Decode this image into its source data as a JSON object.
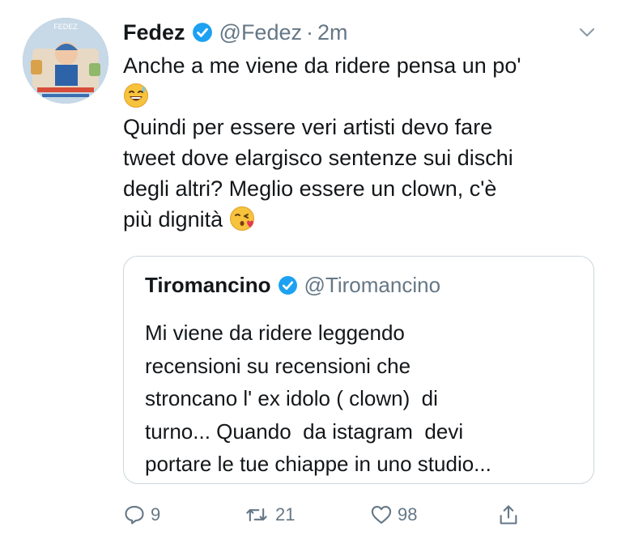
{
  "tweet": {
    "author_name": "Fedez",
    "author_handle": "@Fedez",
    "separator": "·",
    "time": "2m",
    "text_lines": [
      "Anche a me viene da ridere pensa un po'",
      "",
      "Quindi per essere veri artisti devo fare",
      "tweet dove elargisco sentenze sui dischi",
      "degli altri? Meglio essere un clown, c'è",
      "più dignità"
    ],
    "avatar_caption": "FEDEZ"
  },
  "quoted_tweet": {
    "author_name": "Tiromancino",
    "author_handle": "@Tiromancino",
    "text_lines": [
      "Mi viene da ridere leggendo",
      "recensioni su recensioni che",
      "stroncano l' ex idolo ( clown)  di",
      "turno... Quando  da istagram  devi",
      "portare le tue chiappe in uno studio..."
    ]
  },
  "actions": {
    "replies": "9",
    "retweets": "21",
    "likes": "98"
  },
  "icons": {
    "verified": "verified-badge-icon",
    "caret": "chevron-down-icon",
    "reply": "reply-icon",
    "retweet": "retweet-icon",
    "like": "heart-icon",
    "share": "share-icon",
    "emoji_1": "sweat-smile-emoji",
    "emoji_2": "kiss-emoji"
  },
  "colors": {
    "verified": "#1da1f2",
    "secondary_text": "#657786",
    "border": "#ccd6dd"
  }
}
